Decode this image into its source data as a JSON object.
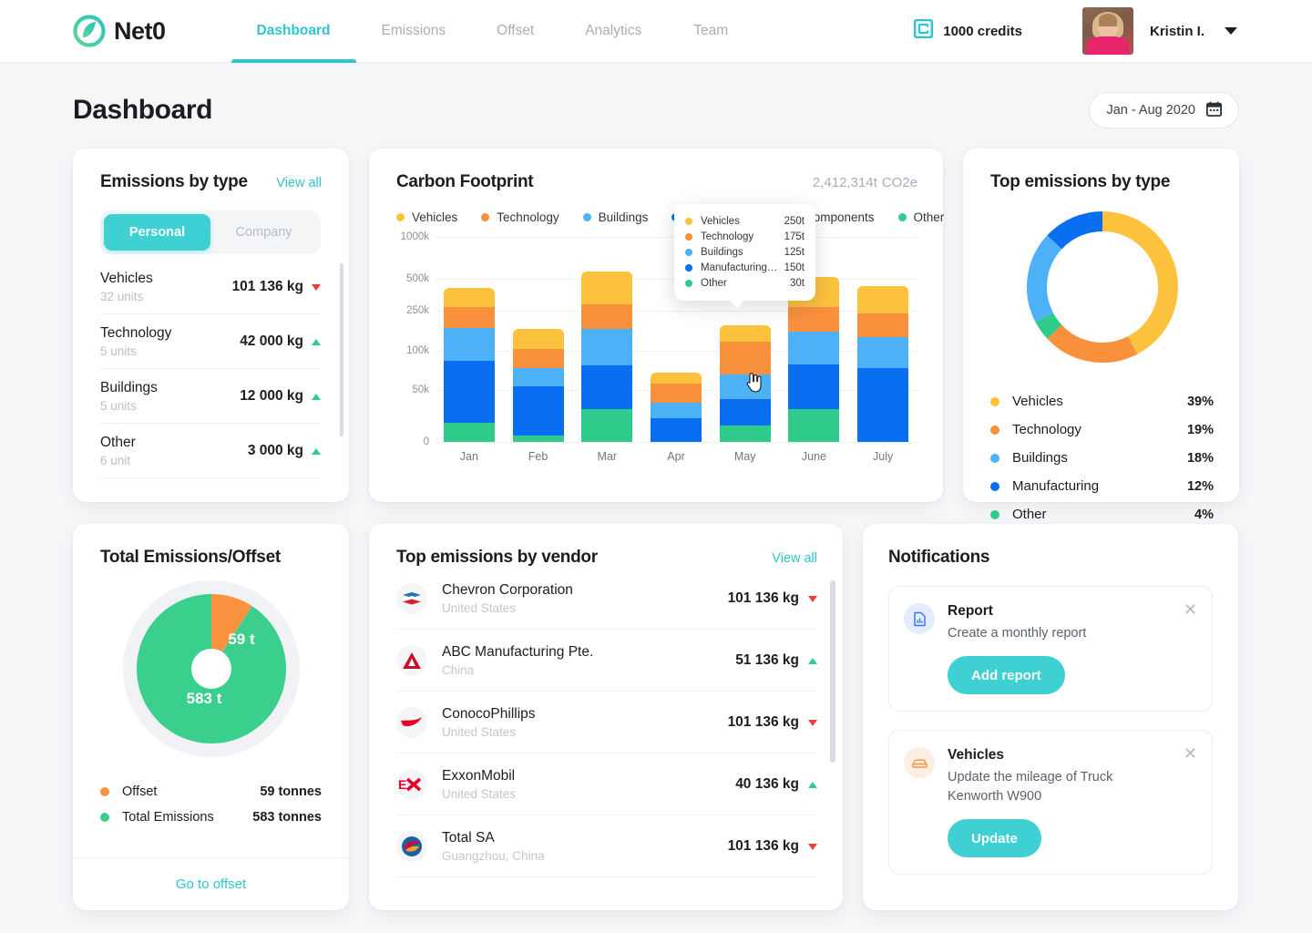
{
  "brand": {
    "name": "Net0"
  },
  "nav": {
    "items": [
      {
        "label": "Dashboard",
        "active": true
      },
      {
        "label": "Emissions",
        "active": false
      },
      {
        "label": "Offset",
        "active": false
      },
      {
        "label": "Analytics",
        "active": false
      },
      {
        "label": "Team",
        "active": false
      }
    ]
  },
  "topbar": {
    "credits_label": "1000 credits",
    "user_name": "Kristin I."
  },
  "page": {
    "title": "Dashboard",
    "date_range": "Jan - Aug 2020"
  },
  "emissions_by_type": {
    "title": "Emissions by type",
    "view_all": "View all",
    "tabs": [
      {
        "label": "Personal",
        "active": true
      },
      {
        "label": "Company",
        "active": false
      }
    ],
    "rows": [
      {
        "name": "Vehicles",
        "units": "32 units",
        "value": "101 136 kg",
        "trend": "down"
      },
      {
        "name": "Technology",
        "units": "5 units",
        "value": "42 000 kg",
        "trend": "up"
      },
      {
        "name": "Buildings",
        "units": "5 units",
        "value": "12 000 kg",
        "trend": "up"
      },
      {
        "name": "Other",
        "units": "6 unit",
        "value": "3 000 kg",
        "trend": "up"
      }
    ]
  },
  "carbon_footprint": {
    "title": "Carbon Footprint",
    "total": "2,412,314t",
    "total_unit": "CO2e",
    "legend": [
      {
        "label": "Vehicles",
        "color": "#fcc13d"
      },
      {
        "label": "Technology",
        "color": "#f9913c"
      },
      {
        "label": "Buildings",
        "color": "#4cb1f7"
      },
      {
        "label": "Manufacturing",
        "color": "#0a6ef0"
      },
      {
        "label": "Components",
        "color": "#0a6ef0"
      },
      {
        "label": "Other",
        "color": "#2ecb8b"
      }
    ],
    "tooltip": {
      "rows": [
        {
          "label": "Vehicles",
          "value": "250t",
          "color": "#fcc13d"
        },
        {
          "label": "Technology",
          "value": "175t",
          "color": "#f9913c"
        },
        {
          "label": "Buildings",
          "value": "125t",
          "color": "#4cb1f7"
        },
        {
          "label": "Manufacturing…",
          "value": "150t",
          "color": "#0a6ef0"
        },
        {
          "label": "Other",
          "value": "30t",
          "color": "#2ecb8b"
        }
      ]
    }
  },
  "chart_data": {
    "type": "bar",
    "title": "Carbon Footprint",
    "xlabel": "",
    "ylabel": "",
    "stacked": true,
    "grid": true,
    "legend_position": "top",
    "categories": [
      "Jan",
      "Feb",
      "Mar",
      "Apr",
      "May",
      "June",
      "July"
    ],
    "ytick_labels": [
      "0",
      "50k",
      "100k",
      "250k",
      "500k",
      "1000k"
    ],
    "ytick_positions_pct": [
      0,
      25.5,
      44.5,
      64,
      79.5,
      100
    ],
    "series": [
      {
        "name": "Other",
        "color": "#2ecb8b",
        "values_pct": [
          9.5,
          3.0,
          16.0,
          0.0,
          8.0,
          16.0,
          0.0
        ]
      },
      {
        "name": "Manufacturing",
        "color": "#0a6ef0",
        "values_pct": [
          30.0,
          24.0,
          21.5,
          11.5,
          13.0,
          22.0,
          36.0
        ]
      },
      {
        "name": "Buildings",
        "color": "#4cb1f7",
        "values_pct": [
          16.0,
          9.0,
          17.5,
          7.5,
          12.0,
          16.0,
          15.0
        ]
      },
      {
        "name": "Technology",
        "color": "#f9913c",
        "values_pct": [
          10.5,
          9.5,
          12.0,
          9.5,
          16.0,
          12.0,
          11.5
        ]
      },
      {
        "name": "Vehicles",
        "color": "#fcc13d",
        "values_pct": [
          9.0,
          9.5,
          16.0,
          5.5,
          8.0,
          14.5,
          13.5
        ]
      }
    ]
  },
  "top_emissions_by_type": {
    "title": "Top emissions by type",
    "donut": {
      "type": "pie",
      "segments": [
        {
          "label": "Vehicles",
          "value": 39,
          "color": "#fcc13d"
        },
        {
          "label": "Technology",
          "value": 19,
          "color": "#f9913c"
        },
        {
          "label": "Buildings",
          "value": 18,
          "color": "#4cb1f7"
        },
        {
          "label": "Manufacturing",
          "value": 12,
          "color": "#0a6ef0"
        },
        {
          "label": "Other",
          "value": 4,
          "color": "#2ecb8b"
        }
      ]
    },
    "rows": [
      {
        "label": "Vehicles",
        "pct": "39%",
        "color": "#fcc13d"
      },
      {
        "label": "Technology",
        "pct": "19%",
        "color": "#f9913c"
      },
      {
        "label": "Buildings",
        "pct": "18%",
        "color": "#4cb1f7"
      },
      {
        "label": "Manufacturing",
        "pct": "12%",
        "color": "#0a6ef0"
      },
      {
        "label": "Other",
        "pct": "4%",
        "color": "#2ecb8b"
      }
    ]
  },
  "total_emissions_offset": {
    "title": "Total Emissions/Offset",
    "pie": {
      "type": "pie",
      "segments": [
        {
          "label": "Offset",
          "value": 59,
          "color": "#f99340",
          "data_label": "59 t"
        },
        {
          "label": "Total Emissions",
          "value": 583,
          "color": "#3bcf8e",
          "data_label": "583 t"
        }
      ]
    },
    "label_offset": "59 t",
    "label_total": "583 t",
    "legend": [
      {
        "label": "Offset",
        "value": "59 tonnes",
        "color": "#f99340"
      },
      {
        "label": "Total Emissions",
        "value": "583 tonnes",
        "color": "#3bcf8e"
      }
    ],
    "footer_link": "Go to offset"
  },
  "vendors": {
    "title": "Top emissions by vendor",
    "view_all": "View all",
    "rows": [
      {
        "name": "Chevron Corporation",
        "country": "United States",
        "value": "101 136 kg",
        "trend": "down",
        "logo": "chevron-logo"
      },
      {
        "name": "ABC Manufacturing Pte.",
        "country": "China",
        "value": "51 136 kg",
        "trend": "up",
        "logo": "abc-logo"
      },
      {
        "name": "ConocoPhillips",
        "country": "United States",
        "value": "101 136 kg",
        "trend": "down",
        "logo": "conoco-logo"
      },
      {
        "name": "ExxonMobil",
        "country": "United States",
        "value": "40 136 kg",
        "trend": "up",
        "logo": "exxon-logo"
      },
      {
        "name": "Total SA",
        "country": "Guangzhou, China",
        "value": "101 136 kg",
        "trend": "down",
        "logo": "total-logo"
      }
    ]
  },
  "notifications": {
    "title": "Notifications",
    "items": [
      {
        "title": "Report",
        "text": "Create a monthly report",
        "button": "Add report",
        "icon": "report-icon",
        "icon_bg": "#e4ecfd",
        "icon_color": "#3b79e8"
      },
      {
        "title": "Vehicles",
        "text": "Update the mileage of Truck Kenworth W900",
        "button": "Update",
        "icon": "car-icon",
        "icon_bg": "#fdeee2",
        "icon_color": "#f9913c"
      }
    ]
  }
}
